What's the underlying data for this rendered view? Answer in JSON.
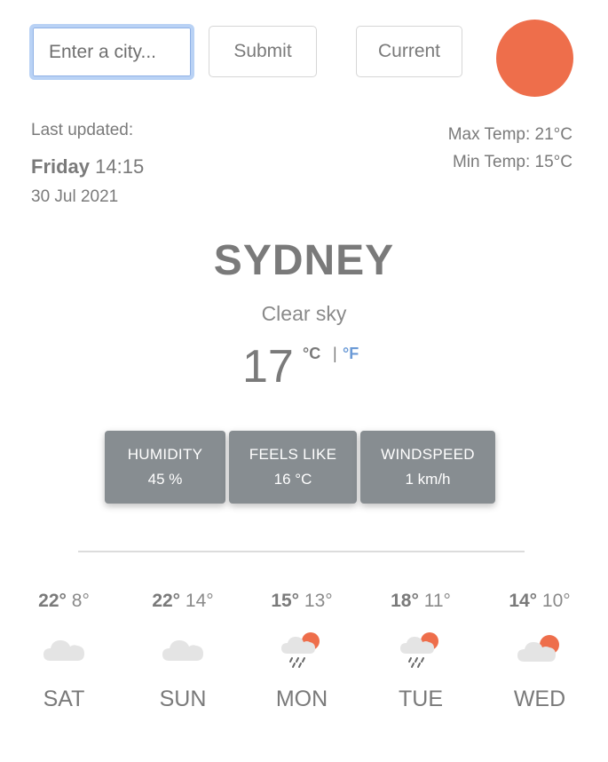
{
  "search": {
    "placeholder": "Enter a city..."
  },
  "buttons": {
    "submit": "Submit",
    "current": "Current"
  },
  "colors": {
    "accent": "#ee6e4b",
    "stat_bg": "#878d91",
    "unit_link": "#6b9ad6"
  },
  "updated": {
    "label": "Last updated:",
    "day": "Friday",
    "time": "14:15",
    "date": "30 Jul 2021"
  },
  "range": {
    "max": "Max Temp: 21°C",
    "min": "Min Temp: 15°C"
  },
  "current": {
    "city": "SYDNEY",
    "condition": "Clear sky",
    "temp": "17",
    "unit_c": "°C",
    "separator": "|",
    "unit_f": "°F"
  },
  "stats": [
    {
      "label": "HUMIDITY",
      "value": "45 %"
    },
    {
      "label": "FEELS LIKE",
      "value": "16 °C"
    },
    {
      "label": "WINDSPEED",
      "value": "1 km/h"
    }
  ],
  "forecast": [
    {
      "hi": "22°",
      "lo": "8°",
      "day": "SAT",
      "icon": "cloud-icon"
    },
    {
      "hi": "22°",
      "lo": "14°",
      "day": "SUN",
      "icon": "cloud-icon"
    },
    {
      "hi": "15°",
      "lo": "13°",
      "day": "MON",
      "icon": "rain-sun-icon"
    },
    {
      "hi": "18°",
      "lo": "11°",
      "day": "TUE",
      "icon": "rain-sun-icon"
    },
    {
      "hi": "14°",
      "lo": "10°",
      "day": "WED",
      "icon": "cloud-sun-icon"
    }
  ]
}
